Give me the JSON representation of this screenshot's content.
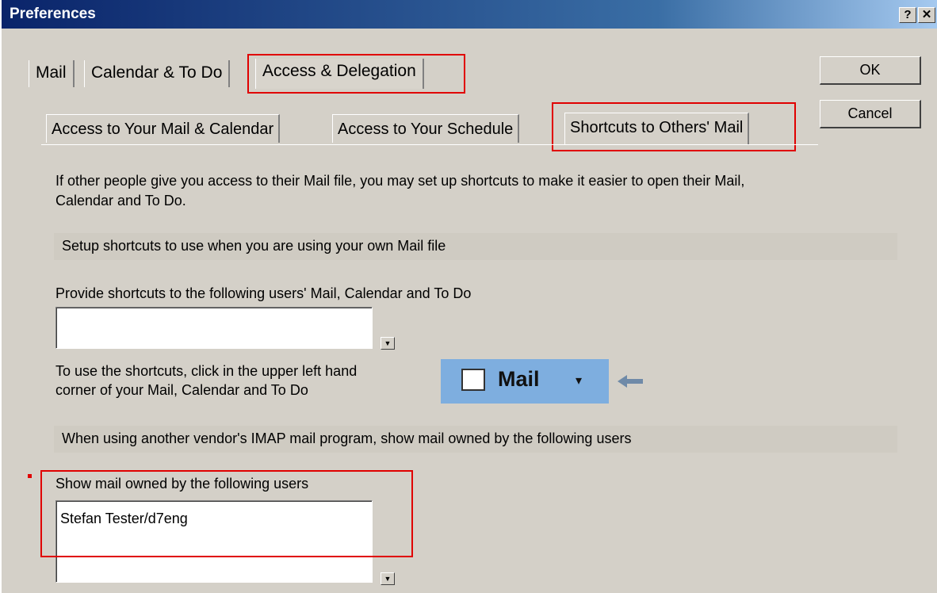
{
  "window": {
    "title": "Preferences",
    "help_glyph": "?",
    "close_glyph": "✕"
  },
  "tabs": [
    {
      "label": "Mail"
    },
    {
      "label": "Calendar & To Do"
    },
    {
      "label": "Access & Delegation"
    }
  ],
  "subtabs": [
    {
      "label": "Access to Your Mail & Calendar"
    },
    {
      "label": "Access to Your Schedule"
    },
    {
      "label": "Shortcuts to Others' Mail"
    }
  ],
  "buttons": {
    "ok": "OK",
    "cancel": "Cancel"
  },
  "content": {
    "intro_line1": "If other people give you access to their Mail file, you may set up shortcuts to make it easier to open their Mail,",
    "intro_line2": "Calendar and To Do.",
    "section1": "Setup shortcuts to use when you are using your own Mail file",
    "provide_label": "Provide shortcuts to the following users' Mail, Calendar and To Do",
    "provide_value": "",
    "use_line1": "To use the shortcuts, click in the upper left hand",
    "use_line2": "corner of your Mail, Calendar and To Do",
    "mail_label": "Mail",
    "mail_caret": "▾",
    "section2": "When using another vendor's IMAP mail program, show mail owned by the following users",
    "show_label": "Show mail owned by the following users",
    "show_value": "Stefan Tester/d7eng"
  },
  "colors": {
    "titlebar": "#0a246a",
    "highlight": "#e00000",
    "mail_bar": "#7eaedf"
  }
}
